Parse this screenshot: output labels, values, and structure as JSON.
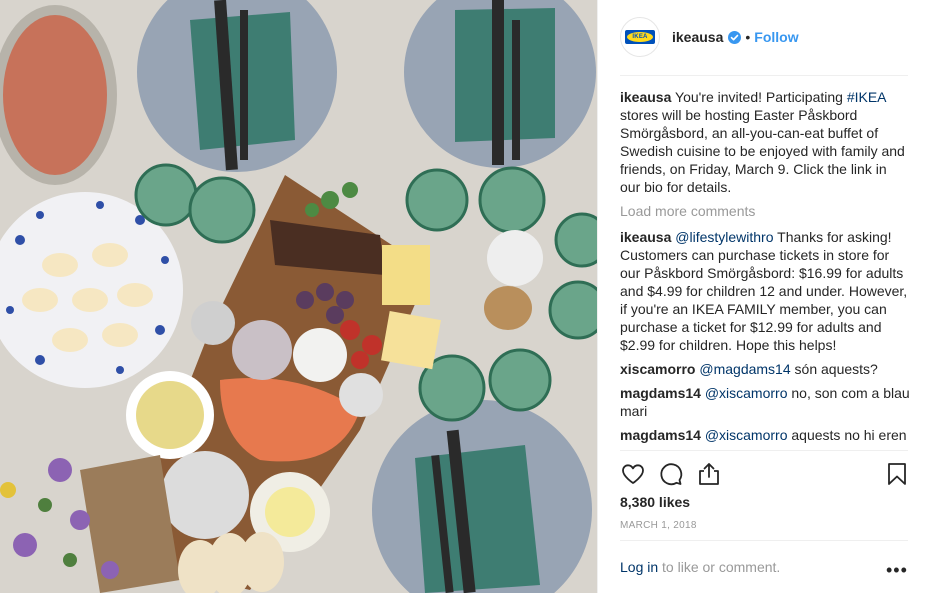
{
  "post": {
    "username": "ikeausa",
    "follow_label": "Follow",
    "dot": "•",
    "logo_text": "IKEA",
    "caption": {
      "user": "ikeausa",
      "text_before": " You're invited! Participating ",
      "hashtag": "#IKEA",
      "text_after": " stores will be hosting Easter Påskbord Smörgåsbord, an all-you-can-eat buffet of Swedish cuisine to be enjoyed with family and friends, on Friday, March 9. Click the link in our bio for details."
    },
    "load_more": "Load more comments",
    "comments": [
      {
        "user": "ikeausa",
        "mention": "@lifestylewithro",
        "text": " Thanks for asking! Customers can purchase tickets in store for our Påskbord Smörgåsbord: $16.99 for adults and $4.99 for children 12 and under. However, if you're an IKEA FAMILY member, you can purchase a ticket for $12.99 for adults and $2.99 for children. Hope this helps!"
      },
      {
        "user": "xiscamorro",
        "mention": "@magdams14",
        "text": " són aquests?"
      },
      {
        "user": "magdams14",
        "mention": "@xiscamorro",
        "text": " no, son com a blau mari"
      },
      {
        "user": "magdams14",
        "mention": "@xiscamorro",
        "text": " aquests no hi eren"
      }
    ],
    "icons": {
      "like": "heart-icon",
      "comment": "comment-icon",
      "share": "share-icon",
      "save": "bookmark-icon",
      "verified": "verified-badge-icon"
    },
    "likes": "8,380 likes",
    "date": "MARCH 1, 2018",
    "footer": {
      "login": "Log in",
      "rest": " to like or comment."
    },
    "more": "•••",
    "colors": {
      "link": "#003569",
      "follow": "#3897f0",
      "muted": "#999999",
      "verified": "#3897f0",
      "ikea_blue": "#0051ba",
      "ikea_yellow": "#ffda1a"
    }
  }
}
